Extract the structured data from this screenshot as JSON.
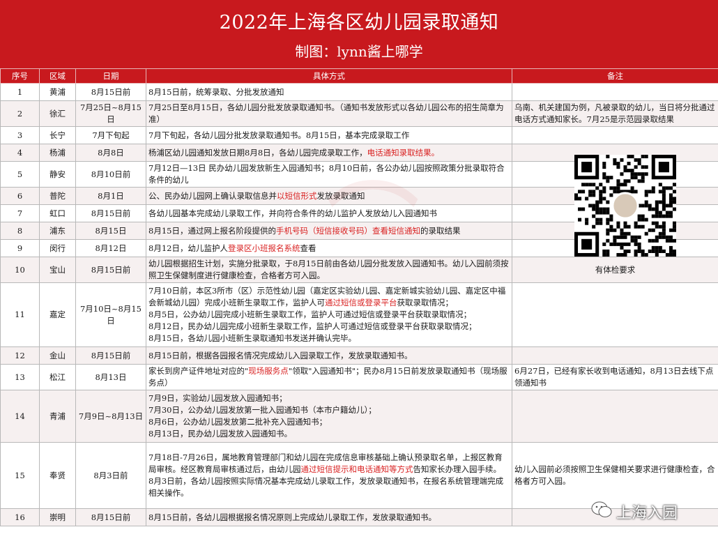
{
  "header": {
    "title": "2022年上海各区幼儿园录取通知",
    "subtitle": "制图：lynn酱上哪学"
  },
  "columns": [
    "序号",
    "区域",
    "日期",
    "具体方式",
    "备注"
  ],
  "rows": [
    {
      "no": "1",
      "district": "黄浦",
      "date": "8月15日前",
      "method": "8月15日前，统筹录取、分批发放通知",
      "note": ""
    },
    {
      "no": "2",
      "district": "徐汇",
      "date": "7月25日~8月15日",
      "method": "7月25日至8月15日，各幼儿园分批发放录取通知书。（通知书发放形式以各幼儿园公布的招生简章为准）",
      "note": "乌南、机关建国为例，凡被录取的幼儿，当日将分批通过电话方式通知家长。7月25是示范园录取结果"
    },
    {
      "no": "3",
      "district": "长宁",
      "date": "7月下旬起",
      "method": "7月下旬起，各幼儿园分批发放录取通知书。8月15日，基本完成录取工作",
      "note": ""
    },
    {
      "no": "4",
      "district": "杨浦",
      "date": "8月8日",
      "method_parts": [
        "杨浦区幼儿园通知发放日期8月8日，各幼儿园完成录取工作，",
        "电话通知录取结果。"
      ],
      "note": ""
    },
    {
      "no": "5",
      "district": "静安",
      "date": "8月10日前",
      "method": "7月12日—13日  民办幼儿园发放新生入园通知书；8月10日前，各公办幼儿园按照政策分批录取符合条件的幼儿",
      "note": ""
    },
    {
      "no": "6",
      "district": "普陀",
      "date": "8月1日",
      "method_parts": [
        "公、民办幼儿园网上确认录取信息并",
        "以短信形式",
        "发放录取通知"
      ],
      "note": ""
    },
    {
      "no": "7",
      "district": "虹口",
      "date": "8月15日前",
      "method": "各幼儿园基本完成幼儿录取工作，并向符合条件的幼儿监护人发放幼儿入园通知书",
      "note": ""
    },
    {
      "no": "8",
      "district": "浦东",
      "date": "8月15日",
      "method_parts": [
        "8月15日，通过网上报名阶段提供的",
        "手机号码（短信接收号码）查看短信通知",
        "的录取结果"
      ],
      "note": ""
    },
    {
      "no": "9",
      "district": "闵行",
      "date": "8月12日",
      "method_parts": [
        "8月12日，幼儿监护人",
        "登录区小班报名系统",
        "查看"
      ],
      "note": ""
    },
    {
      "no": "10",
      "district": "宝山",
      "date": "8月15日前",
      "method": "幼儿园根据招生计划，实施分批录取，于8月15日前由各幼儿园分批发放入园通知书。幼儿入园前须按照卫生保健制度进行健康检查，合格者方可入园。",
      "note": "有体检要求"
    },
    {
      "no": "11",
      "district": "嘉定",
      "date": "7月10日~8月15日",
      "method_lines": [
        [
          "7月10日前，本区3所市（区）示范性幼儿园（嘉定区实验幼儿园、嘉定新城实验幼儿园、嘉定区中福会新城幼儿园）完成小班新生录取工作，监护人可",
          "通过短信或登录平台",
          "获取录取情况；"
        ],
        [
          "8月5日，公办幼儿园完成小班新生录取工作，监护人可通过短信或登录平台获取录取情况；",
          "",
          ""
        ],
        [
          "8月12日，民办幼儿园完成小班新生录取工作，监护人可通过短信或登录平台获取录取情况；",
          "",
          ""
        ],
        [
          "8月15日，各幼儿园小班新生录取通知书发送并确认完毕。",
          "",
          ""
        ]
      ],
      "note": ""
    },
    {
      "no": "12",
      "district": "金山",
      "date": "8月15日前",
      "method": "8月15日前，根据各园报名情况完成幼儿入园录取工作，发放录取通知书。",
      "note": ""
    },
    {
      "no": "13",
      "district": "松江",
      "date": "8月13日",
      "method_parts": [
        "家长到房产证件地址对应的\"",
        "现场服务点",
        "\"领取\"入园通知书\"；民办8月15日前发放录取通知书（现场服务点）"
      ],
      "note": "6月27日，已经有家长收到电话通知，8月13日去线下点领通知书"
    },
    {
      "no": "14",
      "district": "青浦",
      "date": "7月9日~8月13日",
      "method_lines": [
        [
          "7月9日，实验幼儿园发放入园通知书；",
          "",
          ""
        ],
        [
          "7月30日，公办幼儿园发放第一批入园通知书（本市户籍幼儿）；",
          "",
          ""
        ],
        [
          "8月6日，公办幼儿园发放第二批补充入园通知书；",
          "",
          ""
        ],
        [
          "8月13日，民办幼儿园发放入园通知书。",
          "",
          ""
        ]
      ],
      "note": ""
    },
    {
      "no": "15",
      "district": "奉贤",
      "date": "8月3日前",
      "method_lines": [
        [
          " 7月18日-7月26日，属地教育管理部门和幼儿园在完成信息审核基础上确认预录取名单，上报区教育局审核。经区教育局审核通过后，由幼儿园",
          "通过短信提示和电话通知等方式",
          "告知家长办理入园手续。"
        ],
        [
          "8月3日前，各幼儿园按照实际情况基本完成幼儿录取工作，发放录取通知书，在报名系统管理端完成相关操作。",
          "",
          ""
        ]
      ],
      "note": "幼儿入园前必须按照卫生保健相关要求进行健康检查，合格者方可入园。"
    },
    {
      "no": "16",
      "district": "崇明",
      "date": "8月15日前",
      "method": "8月15日前，各幼儿园根据报名情况原则上完成幼儿录取工作，发放录取通知书。",
      "note": ""
    }
  ],
  "footer": {
    "account": "上海入园"
  },
  "colors": {
    "header_red": "#c8191e",
    "highlight_red": "#d92323"
  },
  "icons": {
    "qr_code": "qr-code-icon",
    "wechat": "wechat-bubble-icon"
  }
}
